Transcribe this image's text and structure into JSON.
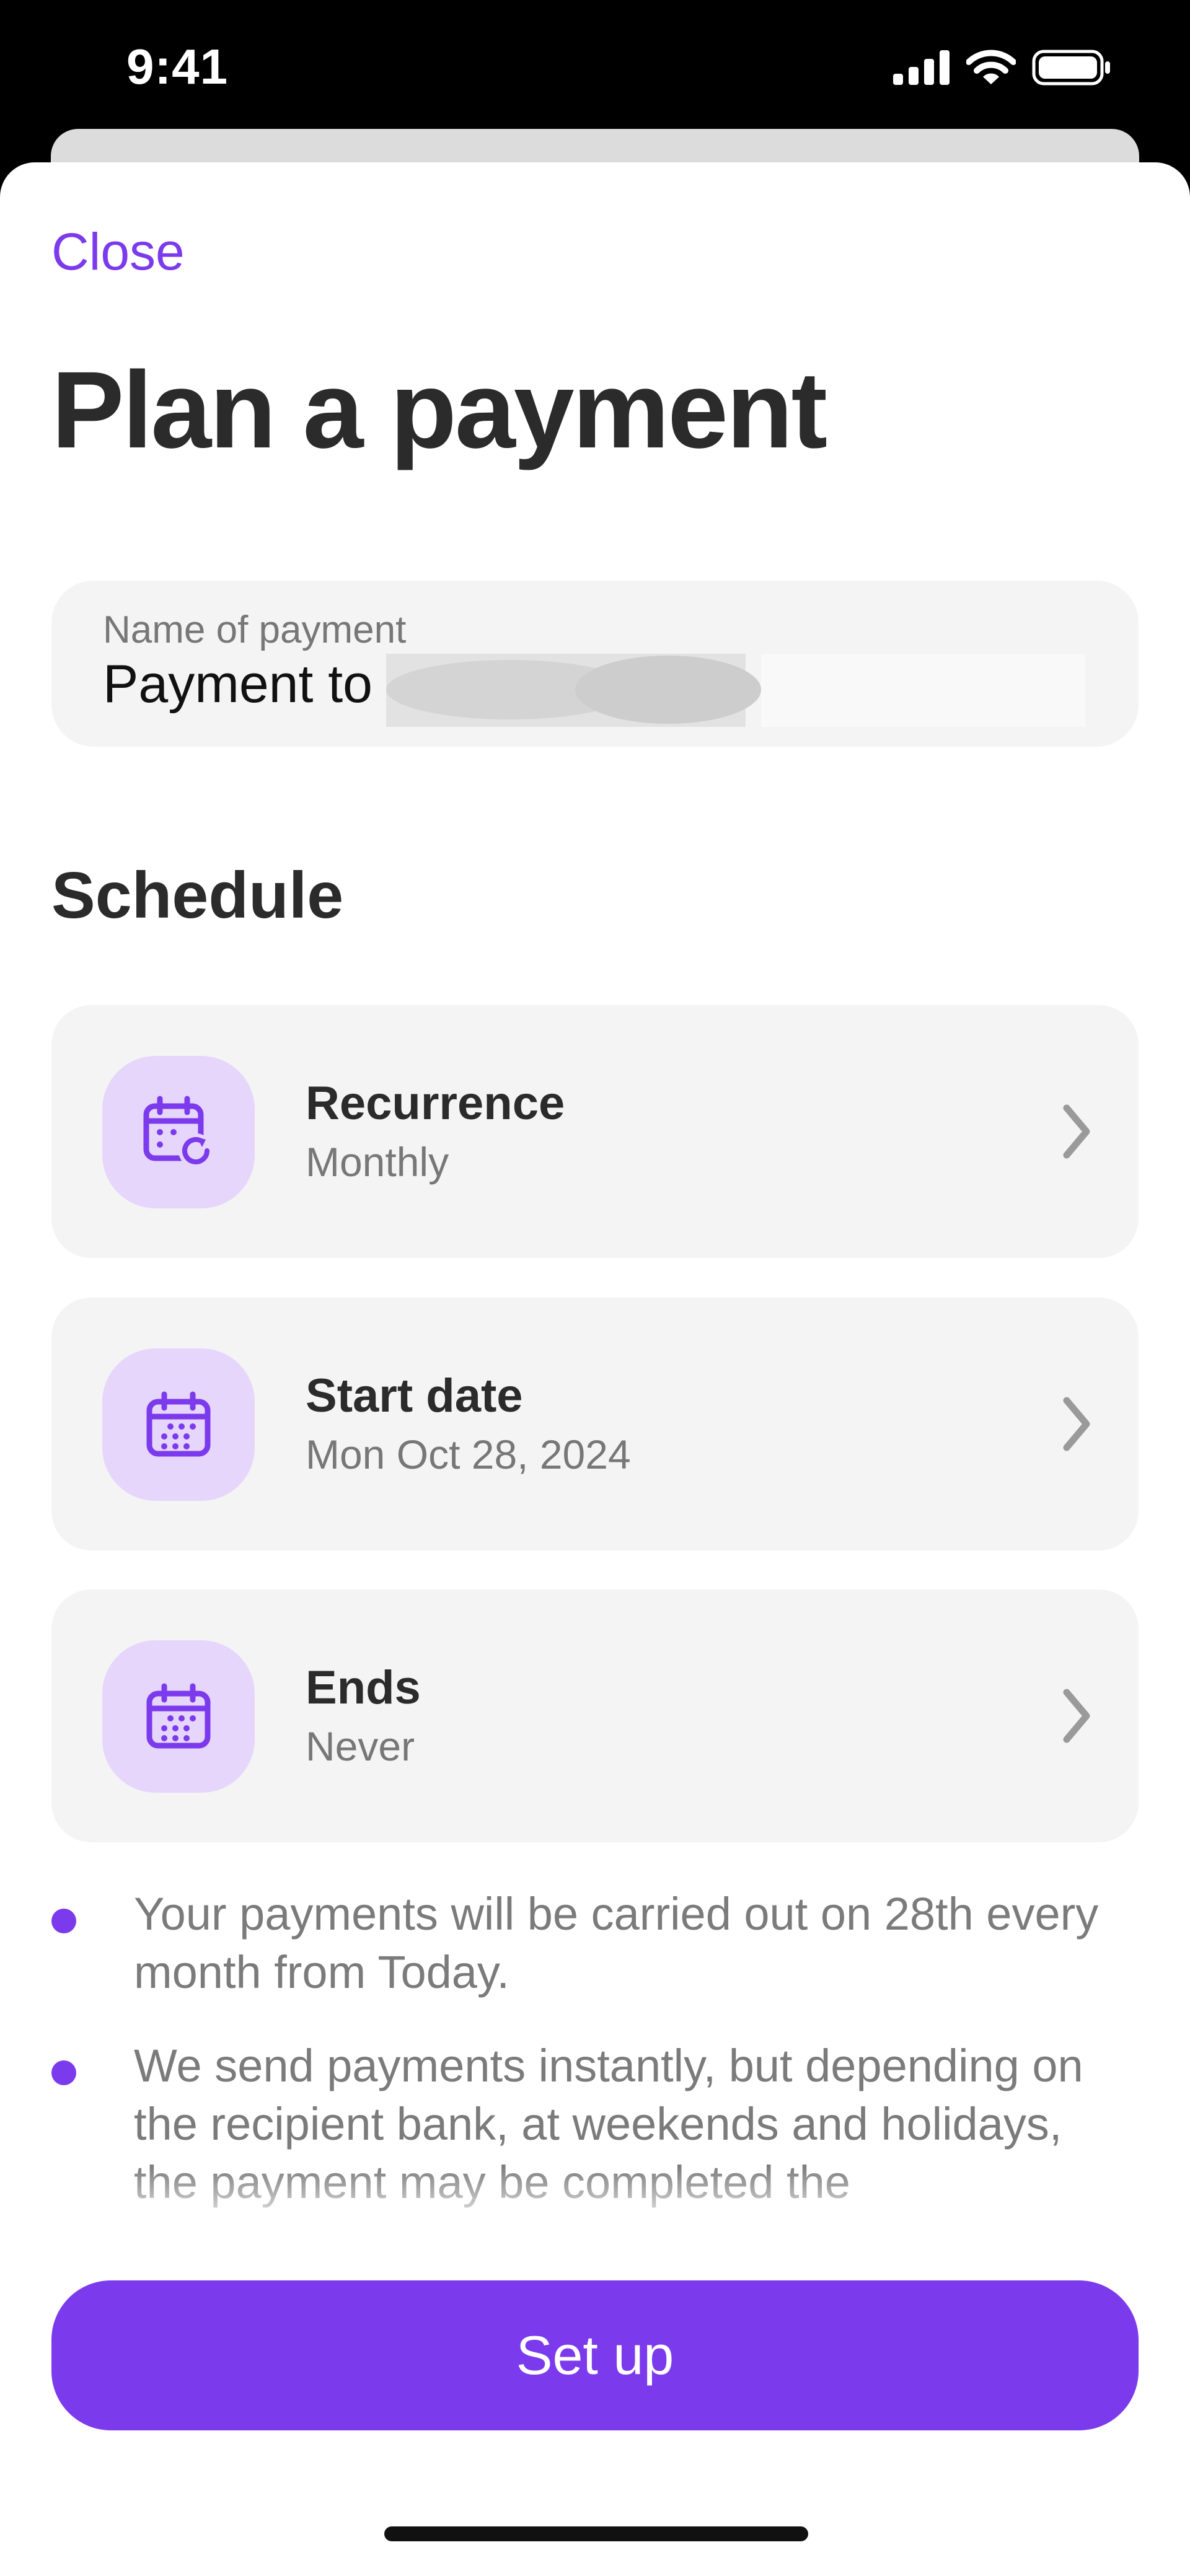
{
  "status_bar": {
    "time": "9:41",
    "icons": [
      "signal-icon",
      "wifi-icon",
      "battery-icon"
    ]
  },
  "sheet": {
    "close_label": "Close",
    "title": "Plan a payment"
  },
  "name_field": {
    "label": "Name of payment",
    "value_prefix": "Payment to"
  },
  "schedule": {
    "title": "Schedule",
    "items": [
      {
        "title": "Recurrence",
        "value": "Monthly",
        "icon": "calendar-repeat-icon"
      },
      {
        "title": "Start date",
        "value": "Mon Oct 28, 2024",
        "icon": "calendar-icon"
      },
      {
        "title": "Ends",
        "value": "Never",
        "icon": "calendar-icon"
      }
    ]
  },
  "notes": [
    "Your payments will be carried out on 28th every month from Today.",
    "We send payments instantly, but depending on the recipient bank, at weekends and holidays, the payment may be completed the"
  ],
  "cta": {
    "label": "Set up"
  },
  "colors": {
    "accent": "#7c3aed",
    "icon_bg": "#e6d6fc",
    "card_bg": "#f4f4f4",
    "text_dark": "#2b2b2b",
    "text_muted": "#777777"
  }
}
